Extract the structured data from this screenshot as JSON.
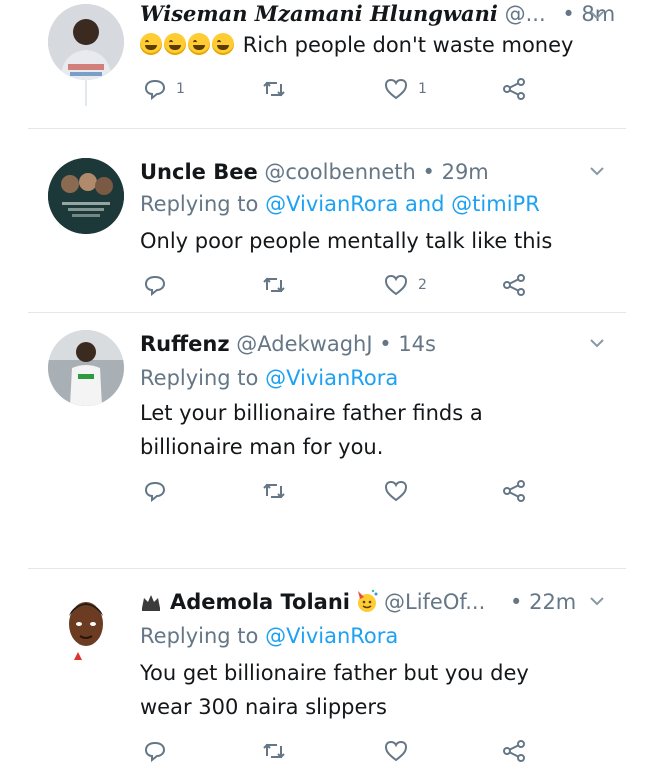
{
  "tweets": [
    {
      "name": "Wiseman Mzamani Hlungwani",
      "handle": "@...",
      "time": "8m",
      "text": "Rich people don't waste money",
      "reply_count": "1",
      "like_count": "1"
    },
    {
      "name": "Uncle Bee",
      "handle": "@coolbenneth",
      "time": "29m",
      "replying_prefix": "Replying to",
      "mention1": "@VivianRora",
      "and": "and",
      "mention2": "@timiPR",
      "text": "Only poor people mentally talk like this",
      "like_count": "2"
    },
    {
      "name": "Ruffenz",
      "handle": "@AdekwaghJ",
      "time": "14s",
      "replying_prefix": "Replying to",
      "mention1": "@VivianRora",
      "text_line1": "Let your billionaire father finds a",
      "text_line2": "billionaire man for you."
    },
    {
      "name": "Ademola Tolani",
      "handle": "@LifeOf...",
      "time": "22m",
      "replying_prefix": "Replying to",
      "mention1": "@VivianRora",
      "text_line1": "You get billionaire father but you dey",
      "text_line2": "wear 300 naira slippers"
    }
  ],
  "dot": "•",
  "colors": {
    "secondary_text": "#657786",
    "link": "#1da1f2",
    "divider": "#e1e8ed"
  }
}
